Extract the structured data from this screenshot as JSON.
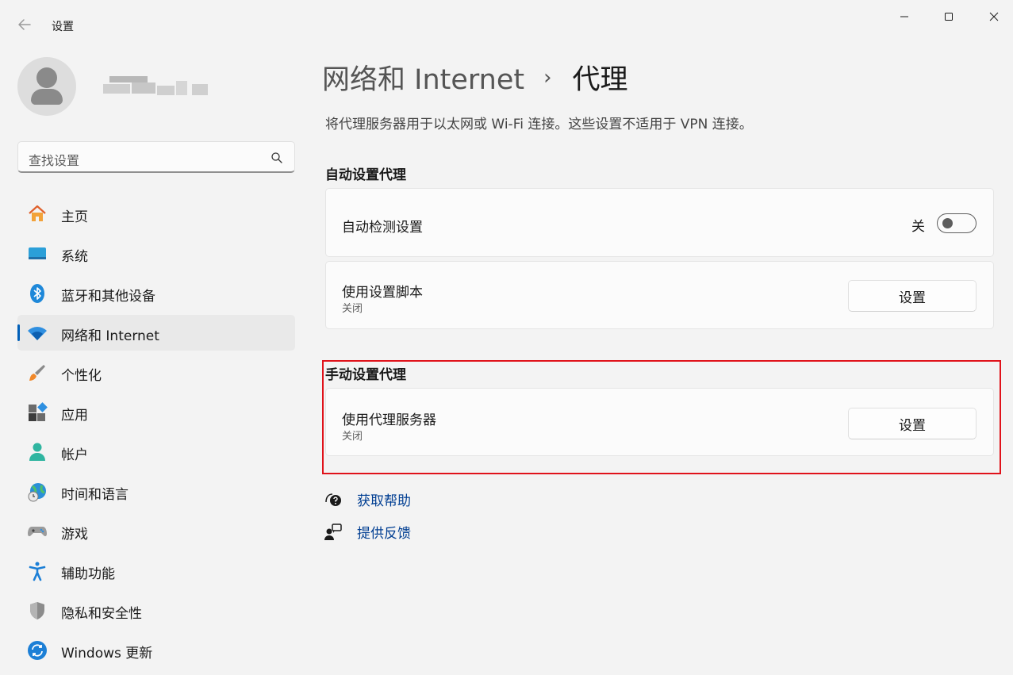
{
  "window": {
    "app_title": "设置"
  },
  "search": {
    "placeholder": "查找设置"
  },
  "nav": {
    "items": [
      {
        "label": "主页"
      },
      {
        "label": "系统"
      },
      {
        "label": "蓝牙和其他设备"
      },
      {
        "label": "网络和 Internet",
        "selected": true
      },
      {
        "label": "个性化"
      },
      {
        "label": "应用"
      },
      {
        "label": "帐户"
      },
      {
        "label": "时间和语言"
      },
      {
        "label": "游戏"
      },
      {
        "label": "辅助功能"
      },
      {
        "label": "隐私和安全性"
      },
      {
        "label": "Windows 更新"
      }
    ]
  },
  "header": {
    "breadcrumb_parent": "网络和 Internet",
    "breadcrumb_separator": "›",
    "title": "代理",
    "description": "将代理服务器用于以太网或 Wi-Fi 连接。这些设置不适用于 VPN 连接。"
  },
  "auto_proxy": {
    "section_title": "自动设置代理",
    "auto_detect": {
      "label": "自动检测设置",
      "state_label": "关",
      "enabled": false
    },
    "setup_script": {
      "label": "使用设置脚本",
      "status": "关闭",
      "button_label": "设置"
    }
  },
  "manual_proxy": {
    "section_title": "手动设置代理",
    "use_proxy": {
      "label": "使用代理服务器",
      "status": "关闭",
      "button_label": "设置"
    }
  },
  "links": {
    "help": "获取帮助",
    "feedback": "提供反馈"
  },
  "colors": {
    "accent": "#005fb8",
    "link": "#003e92",
    "highlight_border": "#e0121a",
    "background": "#f3f3f3"
  },
  "icons": [
    "back-arrow-icon",
    "minimize-icon",
    "maximize-icon",
    "close-icon",
    "search-icon",
    "home-icon",
    "system-icon",
    "bluetooth-icon",
    "wifi-icon",
    "personalization-brush-icon",
    "apps-icon",
    "account-icon",
    "time-language-icon",
    "gaming-icon",
    "accessibility-icon",
    "privacy-shield-icon",
    "windows-update-icon",
    "help-icon",
    "feedback-icon"
  ]
}
